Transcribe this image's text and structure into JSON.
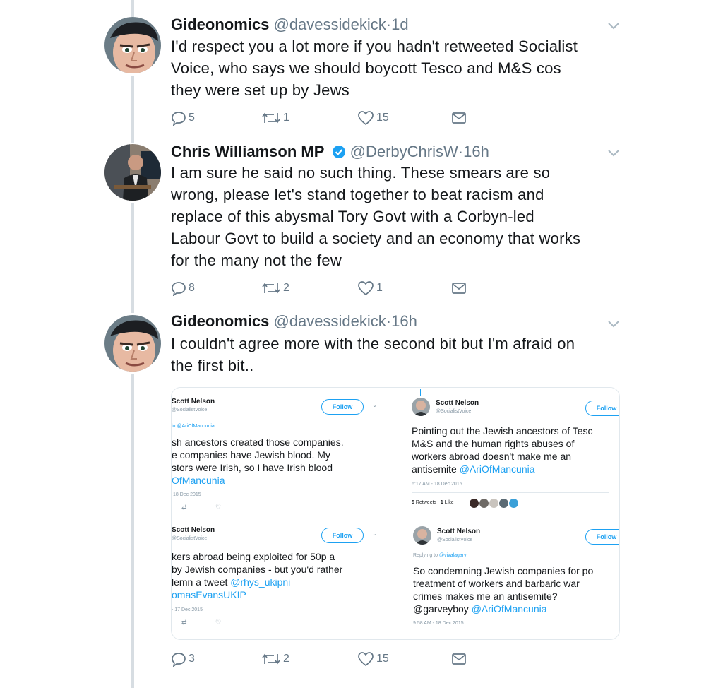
{
  "tweets": [
    {
      "name": "Gideonomics",
      "handle": "@davessidekick",
      "sep": "·",
      "time": "1d",
      "lines": [
        "I'd respect you a lot more if you hadn't retweeted Socialist",
        "Voice, who says we should boycott Tesco and M&S cos",
        "they were set up by Jews"
      ],
      "replies": "5",
      "retweets": "1",
      "likes": "15"
    },
    {
      "name": "Chris Williamson MP",
      "handle": "@DerbyChrisW",
      "sep": "·",
      "time": "16h",
      "lines": [
        "I am sure he said no such thing. These smears are so",
        "wrong, please let's stand together to beat racism and",
        "replace of this abysmal Tory Govt with a Corbyn-led",
        "Labour Govt to build a society and an economy that works",
        "for the many not the few"
      ],
      "replies": "8",
      "retweets": "2",
      "likes": "1"
    },
    {
      "name": "Gideonomics",
      "handle": "@davessidekick",
      "sep": "·",
      "time": "16h",
      "lines": [
        "I couldn't agree more with the second bit but I'm afraid on",
        "the first bit.."
      ],
      "replies": "3",
      "retweets": "2",
      "likes": "15"
    }
  ],
  "embed": {
    "tl": {
      "name": "Scott Nelson",
      "handle": "@SocialistVoice",
      "follow": "Follow",
      "reply_to": "lo @AriOfMancunia",
      "lines": [
        "sh ancestors created those companies.",
        "e companies have Jewish blood. My",
        "stors were Irish, so I have Irish blood"
      ],
      "link": "OfMancunia",
      "time": "18 Dec 2015"
    },
    "tr": {
      "name": "Scott Nelson",
      "handle": "@SocialistVoice",
      "follow": "Follow",
      "lines": [
        "Pointing out the Jewish ancestors of Tesc",
        "M&S and the human rights abuses of",
        "workers abroad doesn't make me an"
      ],
      "last_text": "antisemite ",
      "last_link": "@AriOfMancunia",
      "time": "6:17 AM - 18 Dec 2015",
      "retweets_count": "5",
      "retweets_label": "Retweets",
      "likes_count": "1",
      "likes_label": "Like"
    },
    "bl": {
      "name": "Scott Nelson",
      "handle": "@SocialistVoice",
      "follow": "Follow",
      "lines": [
        "kers abroad being exploited for 50p a",
        "by Jewish companies - but you'd rather"
      ],
      "line3_text": "lemn a tweet ",
      "line3_link": "@rhys_ukipni",
      "line4_link": "omasEvansUKIP",
      "time": "- 17 Dec 2015"
    },
    "br": {
      "name": "Scott Nelson",
      "handle": "@SocialistVoice",
      "follow": "Follow",
      "reply_label": "Replying to ",
      "reply_link": "@vivalagarv",
      "lines": [
        "So condemning Jewish companies for po",
        "treatment of workers and barbaric war",
        "crimes makes me an antisemite?"
      ],
      "last_text": "@garveyboy ",
      "last_link": "@AriOfMancunia",
      "time": "9:58 AM - 18 Dec 2015"
    }
  },
  "colors": {
    "accent": "#1da1f2",
    "muted": "#657786",
    "thread": "#d7dde2",
    "verified": "#1da1f2"
  },
  "icons": [
    "reply-icon",
    "retweet-icon",
    "like-icon",
    "direct-message-icon",
    "chevron-down-icon",
    "verified-badge-icon"
  ]
}
